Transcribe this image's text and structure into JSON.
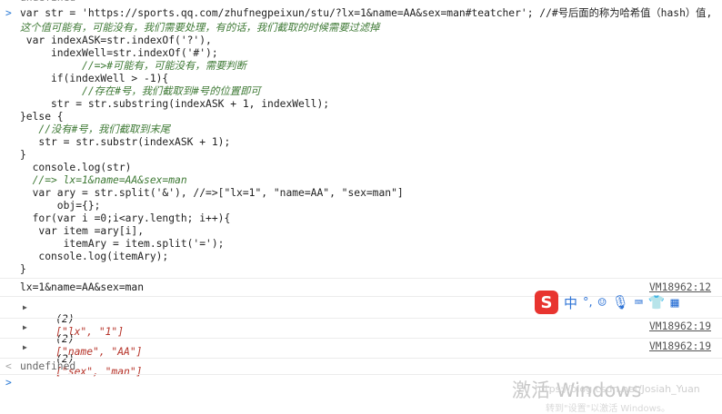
{
  "console": {
    "prev_result": "undefined",
    "code_lines": [
      "var str = 'https://sports.qq.com/zhufnegpeixun/stu/?lx=1&name=AA&sex=man#teatcher'; //#号后面的称为哈希值（hash）值,",
      "这个值可能有，可能没有，我们需要处理，有的话，我们截取的时候需要过滤掉",
      " var indexASK=str.indexOf('?'),",
      "     indexWell=str.indexOf('#');",
      "          //=>#可能有，可能没有，需要判断",
      "     if(indexWell > -1){",
      "          //存在#号，我们截取到#号的位置即可",
      "     str = str.substring(indexASK + 1, indexWell);",
      "}else {",
      "   //没有#号，我们截取到末尾",
      "   str = str.substr(indexASK + 1);",
      "}",
      "  console.log(str)",
      "  //=> lx=1&name=AA&sex=man",
      "  var ary = str.split('&'), //=>[\"lx=1\", \"name=AA\", \"sex=man\"]",
      "      obj={};",
      "  for(var i =0;i<ary.length; i++){",
      "   var item =ary[i],",
      "       itemAry = item.split('=');",
      "   console.log(itemAry);",
      "}"
    ],
    "log_output": "lx=1&name=AA&sex=man",
    "log_source": "VM18962:12",
    "arrays": [
      {
        "count": "(2)",
        "items": "[\"lx\", \"1\"]",
        "source": "VM18962:19"
      },
      {
        "count": "(2)",
        "items": "[\"name\", \"AA\"]",
        "source": "VM18962:19"
      },
      {
        "count": "(2)",
        "items": "[\"sex\", \"man\"]",
        "source": "VM18962:19"
      }
    ],
    "final_result": "undefined",
    "prompt_symbol": ">",
    "result_symbol": "<"
  },
  "ime_toolbar": {
    "logo": "S",
    "mode": "中",
    "punct": "°,",
    "icons": [
      "emoji-icon",
      "microphone-icon",
      "keyboard-icon",
      "shirt-icon",
      "grid-icon"
    ]
  },
  "watermark": {
    "activate": "激活 Windows",
    "csdn": "https://blog.csdn.net/Josiah_Yuan",
    "settings": "转到\"设置\"以激活 Windows。"
  },
  "colors": {
    "keyword": "#8f2bb8",
    "string": "#b6342a",
    "comment": "#3f7a36",
    "number": "#1c38c4",
    "prompt": "#2c7bd6"
  }
}
